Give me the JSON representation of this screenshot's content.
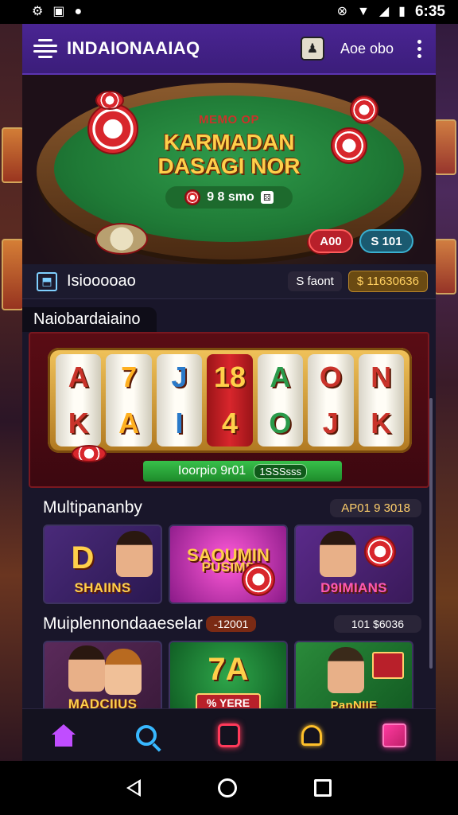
{
  "status_bar": {
    "time": "6:35",
    "left_icons": [
      "settings-icon",
      "image-icon",
      "lock-icon"
    ],
    "right_icons": [
      "vibrate-icon",
      "wifi-icon",
      "signal-icon",
      "battery-icon"
    ]
  },
  "app_bar": {
    "title": "INDAIONAAIAQ",
    "balance": "Aoe obo"
  },
  "hero": {
    "subtitle": "MEMO OP",
    "title_line1": "KARMADAN",
    "title_line2": "DASAGI NOR",
    "pill_text": "9 8 smo",
    "badge_red": "A00",
    "badge_teal": "S 101"
  },
  "info_row": {
    "label": "Isiooooao",
    "button": "S faont",
    "coins": "$ 11630636"
  },
  "slot": {
    "section_label": "Naiobardaiaino",
    "reels": [
      {
        "top": "A",
        "bottom": "K",
        "color": "#c9332a",
        "red": false
      },
      {
        "top": "7",
        "bottom": "A",
        "color": "#ffb020",
        "red": false
      },
      {
        "top": "J",
        "bottom": "I",
        "color": "#2a7ac9",
        "red": false
      },
      {
        "top": "18",
        "bottom": "4",
        "color": "#ffcf4a",
        "red": true
      },
      {
        "top": "A",
        "bottom": "O",
        "color": "#2a9a4a",
        "red": false
      },
      {
        "top": "O",
        "bottom": "J",
        "color": "#c9332a",
        "red": false
      },
      {
        "top": "N",
        "bottom": "K",
        "color": "#c9332a",
        "red": false
      }
    ],
    "bar_text": "Ioorpio 9r01",
    "bar_badge": "1SSSsss"
  },
  "section1": {
    "title": "Multipananby",
    "meta": "AP01 9 3018",
    "cards": [
      {
        "label": "SHAIINS",
        "big": "D"
      },
      {
        "label": "PUSIMS",
        "big": "SAOUMIN"
      },
      {
        "label": "D9IMIANS",
        "big": ""
      }
    ]
  },
  "section2": {
    "title": "Muiplennondaaeselar",
    "meta_red": "-12001",
    "meta_dark": "101 $6036",
    "cards": [
      {
        "label": "MADCIIUS",
        "big": ""
      },
      {
        "label": "% YERE",
        "big": "7A"
      },
      {
        "label": "PanNIIE",
        "big": ""
      }
    ]
  },
  "bottom_nav": [
    "home-icon",
    "search-icon",
    "house-icon",
    "bell-icon",
    "cube-icon"
  ],
  "colors": {
    "accent_purple": "#4a2593",
    "gold": "#ffcf4a",
    "felt_green": "#1f7a36"
  }
}
